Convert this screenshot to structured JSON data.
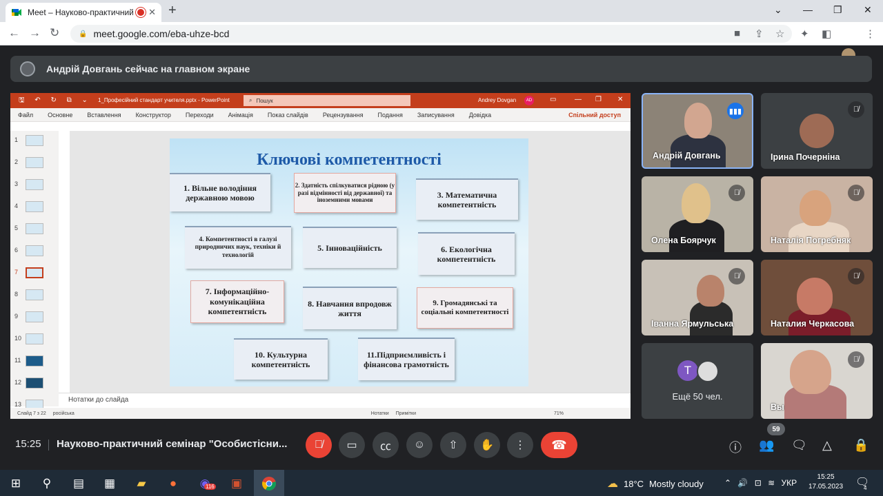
{
  "browser": {
    "tab_title": "Meet – Науково-практичний",
    "url": "meet.google.com/eba-uhze-bcd",
    "close_tab": "✕",
    "new_tab": "+"
  },
  "banner": {
    "text": "Андрій Довгань сейчас на главном экране"
  },
  "ppt": {
    "quick_access": "🖫 ↶ ↻ ⧉ ⌄",
    "filename": "1_Професійний стандарт учителя.pptx  -  PowerPoint",
    "search": "Пошук",
    "user": "Andrey Dovgan",
    "user_initials": "AD",
    "ribbon": [
      "Файл",
      "Основне",
      "Вставлення",
      "Конструктор",
      "Переходи",
      "Анімація",
      "Показ слайдів",
      "Рецензування",
      "Подання",
      "Записування",
      "Довідка"
    ],
    "share": "Спільний доступ",
    "thumb_numbers": [
      "1",
      "2",
      "3",
      "4",
      "5",
      "6",
      "7",
      "8",
      "9",
      "10",
      "11",
      "12",
      "13"
    ],
    "notes": "Нотатки до слайда",
    "status": {
      "slide": "Слайд 7 з 22",
      "lang": "російська",
      "notes_btn": "Нотатки",
      "comments_btn": "Примітки",
      "zoom": "71%"
    }
  },
  "slide": {
    "title": "Ключові компетентності",
    "cards": [
      "1. Вільне володіння державною мовою",
      "2. Здатність спілкуватися рідною (у разі відмінності від державної) та іноземними мовами",
      "3. Математична компетентність",
      "4. Компетентності в галузі природничих наук, техніки й технологій",
      "5. Інноваційність",
      "6. Екологічна компетентність",
      "7. Інформаційно-комунікаційна компетентність",
      "8. Навчання впродовж життя",
      "9. Громадянські та соціальні компетентності",
      "10. Культурна компетентність",
      "11.Підприємливість і фінансова грамотність"
    ]
  },
  "participants": [
    {
      "name": "Андрій Довгань",
      "state": "speaking"
    },
    {
      "name": "Ірина Почерніна",
      "state": "muted"
    },
    {
      "name": "Олена Боярчук",
      "state": "muted"
    },
    {
      "name": "Наталія Погребняк",
      "state": "muted"
    },
    {
      "name": "Іванна Ярмульська",
      "state": "muted"
    },
    {
      "name": "Наталия Черкасова",
      "state": "muted"
    },
    {
      "name": "Вы",
      "state": "muted"
    }
  ],
  "more": {
    "initial": "T",
    "label": "Ещё 50 чел."
  },
  "controls": {
    "time": "15:25",
    "meeting_title": "Науково-практичний семінар \"Особистісни...",
    "participant_count": "59"
  },
  "taskbar": {
    "badge": "116",
    "weather_temp": "18°C",
    "weather_text": "Mostly cloudy",
    "lang": "УКР",
    "time": "15:25",
    "date": "17.05.2023",
    "notifications": "4"
  },
  "colors": {
    "ppt_red": "#c43e1c",
    "meet_red": "#ea4335",
    "meet_dark": "#202124",
    "slide_title": "#1e5aa8"
  }
}
